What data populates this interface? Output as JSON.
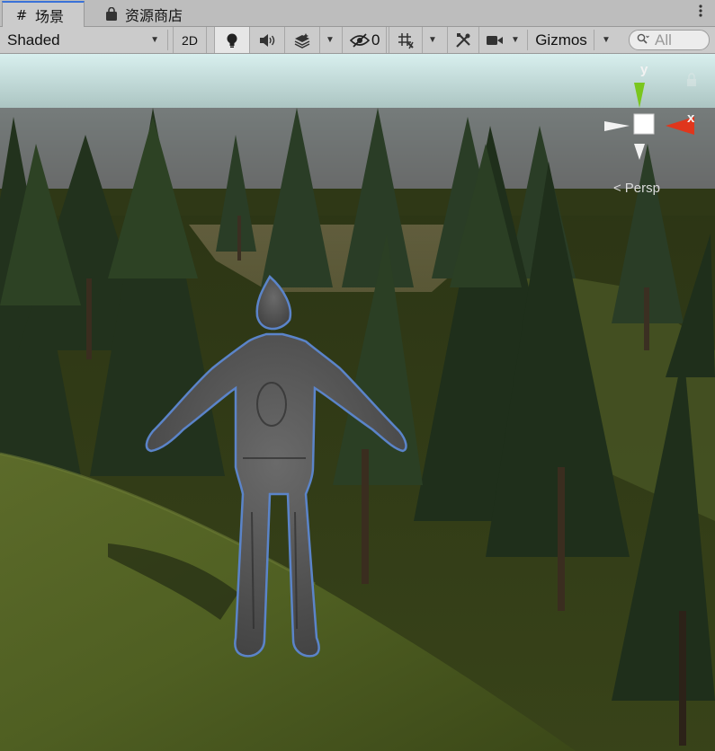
{
  "tabs": [
    {
      "icon": "grid-icon",
      "label": "场景",
      "active": true
    },
    {
      "icon": "bag-icon",
      "label": "资源商店",
      "active": false
    }
  ],
  "toolbar": {
    "shading_mode": "Shaded",
    "mode_2d_label": "2D",
    "hidden_count": "0",
    "gizmos_label": "Gizmos",
    "search_placeholder": "All"
  },
  "gizmo": {
    "y_label": "y",
    "x_label": "x",
    "projection_label": "Persp"
  },
  "colors": {
    "tab_accent": "#3a72d8",
    "axis_x": "#e0361c",
    "axis_y": "#7ac61e",
    "selection_outline": "#5b84c9"
  }
}
